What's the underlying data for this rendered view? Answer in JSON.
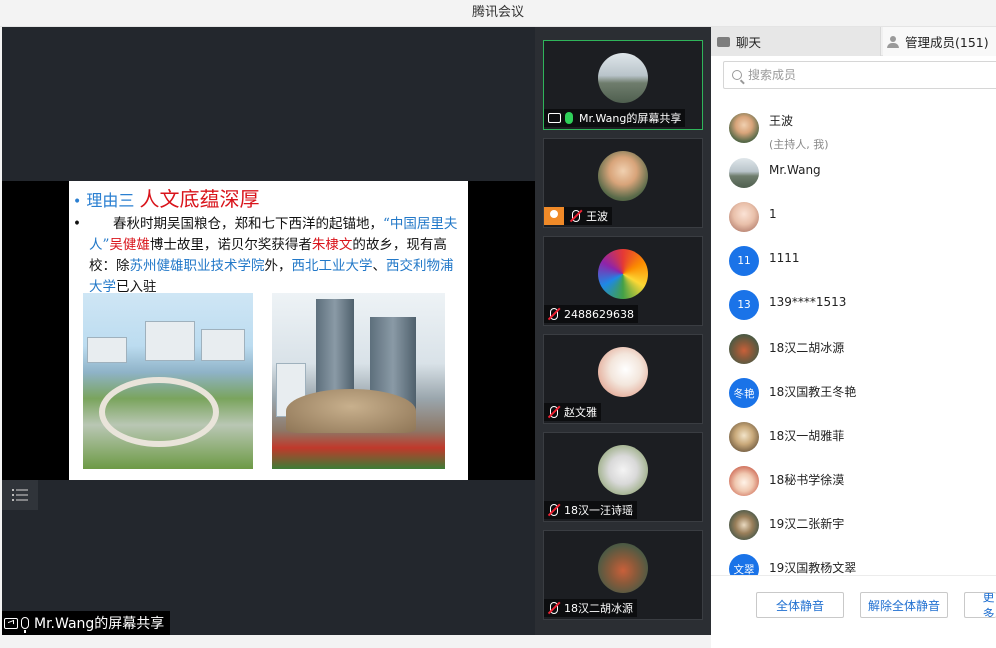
{
  "window": {
    "title": "腾讯会议"
  },
  "share": {
    "label": "Mr.Wang的屏幕共享",
    "slide": {
      "bullet": "•",
      "heading_prefix": "理由三 ",
      "heading_main": "人文底蕴深厚",
      "body_bullet": "•",
      "body_parts": [
        {
          "text": "春秋时期吴国粮仓，郑和七下西洋的起锚地，",
          "color": "black"
        },
        {
          "text": "“中国居里夫人”",
          "color": "blue"
        },
        {
          "text": "吴健雄",
          "color": "red"
        },
        {
          "text": "博士故里，诺贝尔奖获得者",
          "color": "black"
        },
        {
          "text": "朱棣文",
          "color": "red"
        },
        {
          "text": "的故乡，现有高校：除",
          "color": "black"
        },
        {
          "text": "苏州健雄职业技术学院",
          "color": "blue"
        },
        {
          "text": "外，",
          "color": "black"
        },
        {
          "text": "西北工业大学",
          "color": "blue"
        },
        {
          "text": "、",
          "color": "black"
        },
        {
          "text": "西交利物浦大学",
          "color": "blue"
        },
        {
          "text": "已入驻",
          "color": "black"
        }
      ]
    }
  },
  "video_tiles": [
    {
      "name": "Mr.Wang的屏幕共享",
      "active": true,
      "mic": "on",
      "sharing": true,
      "host": false
    },
    {
      "name": "王波",
      "active": false,
      "mic": "muted",
      "sharing": false,
      "host": true
    },
    {
      "name": "2488629638",
      "active": false,
      "mic": "muted",
      "sharing": false,
      "host": false
    },
    {
      "name": "赵文雅",
      "active": false,
      "mic": "muted",
      "sharing": false,
      "host": false
    },
    {
      "name": "18汉一汪诗瑶",
      "active": false,
      "mic": "muted",
      "sharing": false,
      "host": false
    },
    {
      "name": "18汉二胡冰源",
      "active": false,
      "mic": "muted",
      "sharing": false,
      "host": false
    }
  ],
  "panel": {
    "tab_chat": "聊天",
    "tab_members": "管理成员(151)",
    "search_placeholder": "搜索成员",
    "members": [
      {
        "name": "王波",
        "sub": "(主持人, 我)",
        "avatar_text": "",
        "avatar_color": "#6b7b5a"
      },
      {
        "name": "Mr.Wang",
        "sub": "",
        "avatar_text": "",
        "avatar_color": "#8c9aa0"
      },
      {
        "name": "1",
        "sub": "",
        "avatar_text": "",
        "avatar_color": "#e9c9b8"
      },
      {
        "name": "1111",
        "sub": "",
        "avatar_text": "11",
        "avatar_color": "#1a73e8"
      },
      {
        "name": "139****1513",
        "sub": "",
        "avatar_text": "13",
        "avatar_color": "#1a73e8"
      },
      {
        "name": "18汉二胡冰源",
        "sub": "",
        "avatar_text": "",
        "avatar_color": "#5f6b57"
      },
      {
        "name": "18汉国教王冬艳",
        "sub": "",
        "avatar_text": "冬艳",
        "avatar_color": "#1a73e8"
      },
      {
        "name": "18汉一胡雅菲",
        "sub": "",
        "avatar_text": "",
        "avatar_color": "#7a6a58"
      },
      {
        "name": "18秘书学徐漠",
        "sub": "",
        "avatar_text": "",
        "avatar_color": "#c0574a"
      },
      {
        "name": "19汉二张新宇",
        "sub": "",
        "avatar_text": "",
        "avatar_color": "#4d5a4a"
      },
      {
        "name": "19汉国教杨文翠",
        "sub": "",
        "avatar_text": "文翠",
        "avatar_color": "#1a73e8"
      }
    ],
    "buttons": {
      "mute_all": "全体静音",
      "unmute_all": "解除全体静音",
      "more": "更多"
    }
  },
  "colors": {
    "accent": "#1f6fd0",
    "active_border": "#2fb45a",
    "share_bg": "#23272d",
    "highlight_red": "#d9141b",
    "highlight_blue": "#2278c8"
  }
}
